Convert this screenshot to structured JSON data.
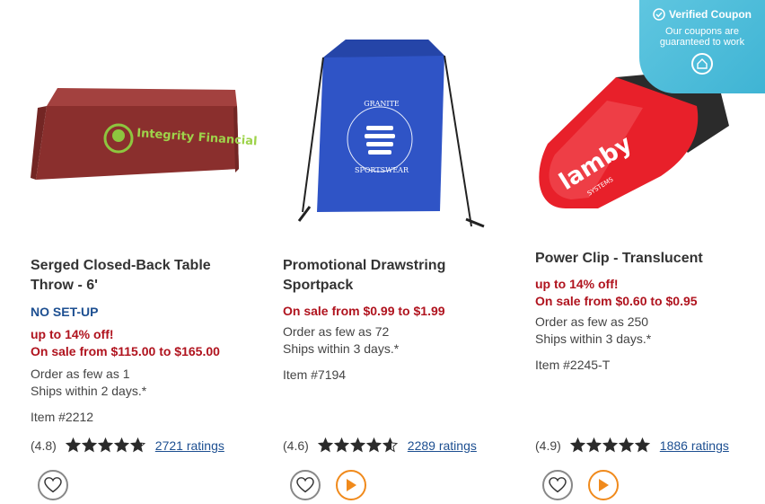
{
  "coupon": {
    "title": "Verified Coupon",
    "subtitle": "Our coupons are guaranteed to work",
    "icon": "check-circle-icon"
  },
  "products": [
    {
      "title": "Serged Closed-Back Table Throw - 6'",
      "badge": "NO SET-UP",
      "discount": "up to 14% off!",
      "sale": "On sale from $115.00 to $165.00",
      "min_order": "Order as few as 1",
      "ships": "Ships within 2 days.*",
      "item": "Item #2212",
      "rating_score": "(4.8)",
      "rating_value": 4.8,
      "ratings_link": "2721 ratings",
      "image_text": "Integrity Financial"
    },
    {
      "title": "Promotional Drawstring Sportpack",
      "sale": "On sale from $0.99 to $1.99",
      "min_order": "Order as few as 72",
      "ships": "Ships within 3 days.*",
      "item": "Item #7194",
      "rating_score": "(4.6)",
      "rating_value": 4.6,
      "ratings_link": "2289 ratings",
      "image_text_top": "GRANITE",
      "image_text_bottom": "SPORTSWEAR"
    },
    {
      "title": "Power Clip - Translucent",
      "discount": "up to 14% off!",
      "sale": "On sale from $0.60 to $0.95",
      "min_order": "Order as few as 250",
      "ships": "Ships within 3 days.*",
      "item": "Item #2245-T",
      "rating_score": "(4.9)",
      "rating_value": 4.9,
      "ratings_link": "1886 ratings",
      "image_text": "lamby",
      "image_subtext": "SYSTEMS"
    }
  ],
  "colors": {
    "accent_blue": "#1d4f91",
    "sale_red": "#b0131e",
    "play_orange": "#f08a1c",
    "coupon_teal": "#46b8d7"
  }
}
